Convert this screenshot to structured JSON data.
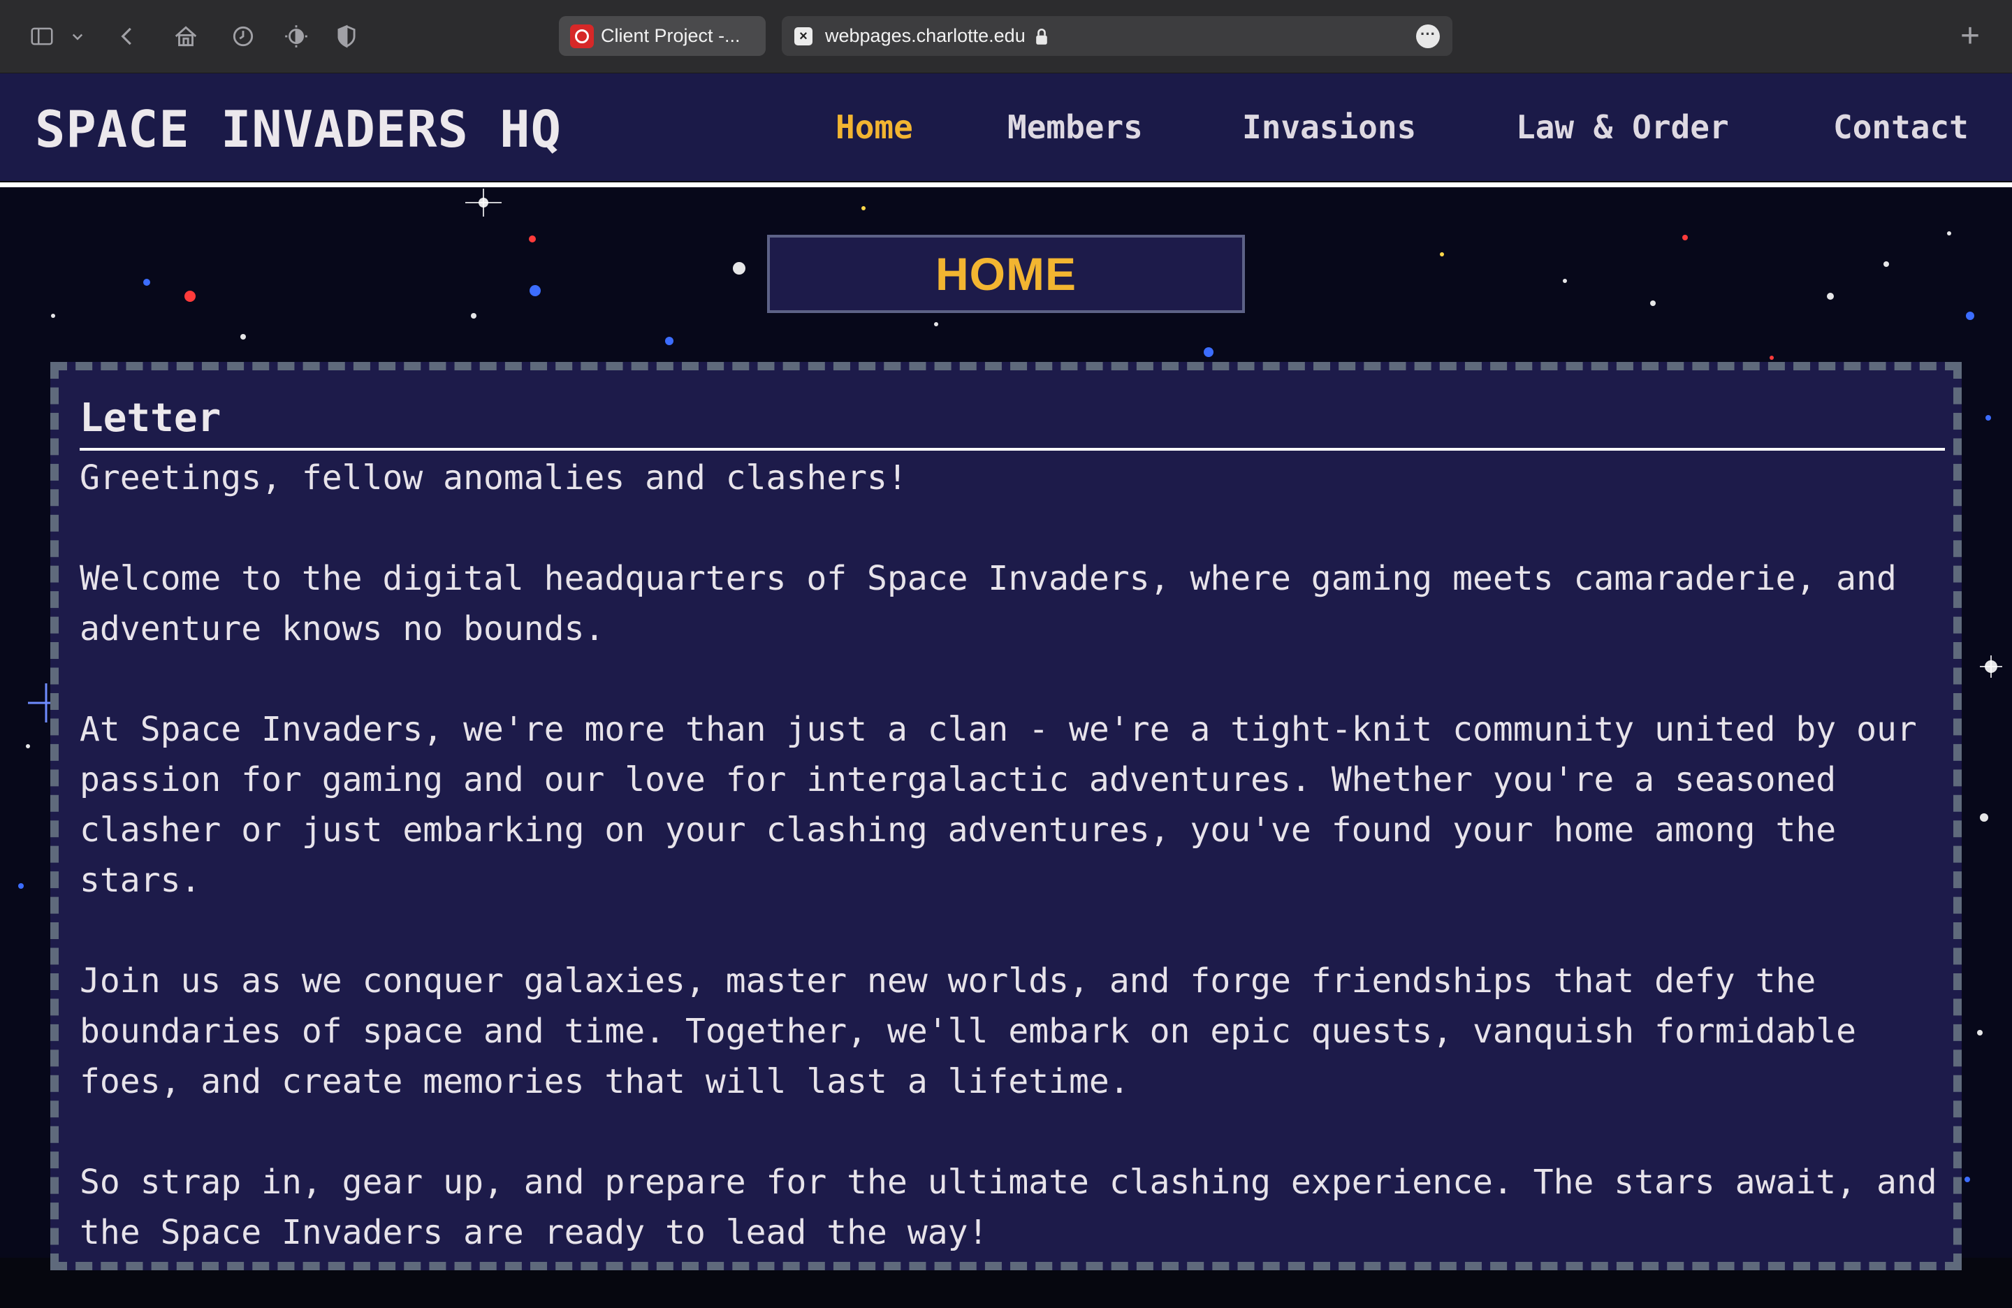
{
  "browser": {
    "tabs": [
      {
        "title": "Client Project -...",
        "active": false
      },
      {
        "title": "webpages.charlotte.edu",
        "active": true
      }
    ],
    "icons": [
      "sidebar-icon",
      "chevron-down-icon",
      "back-icon",
      "home-icon",
      "history-icon",
      "theme-icon",
      "shield-icon",
      "lock-icon",
      "more-icon",
      "new-tab-icon"
    ]
  },
  "site": {
    "logo": "SPACE INVADERS HQ",
    "nav": [
      {
        "label": "Home",
        "active": true
      },
      {
        "label": "Members",
        "active": false
      },
      {
        "label": "Invasions",
        "active": false
      },
      {
        "label": "Law & Order",
        "active": false
      },
      {
        "label": "Contact",
        "active": false
      }
    ],
    "page_title": "HOME",
    "accent_color": "#f2b531",
    "header_color": "#1b1a48"
  },
  "letter": {
    "heading": "Letter",
    "paragraphs": [
      "Greetings, fellow anomalies and clashers!",
      "Welcome to the digital headquarters of Space Invaders, where gaming meets camaraderie, and adventure knows no bounds.",
      "At Space Invaders, we're more than just a clan - we're a tight-knit community united by our passion for gaming and our love for intergalactic adventures. Whether you're a seasoned clasher or just embarking on your clashing adventures, you've found your home among the stars.",
      "Join us as we conquer galaxies, master new worlds, and forge friendships that defy the boundaries of space and time. Together, we'll embark on epic quests, vanquish formidable foes, and create memories that will last a lifetime.",
      "So strap in, gear up, and prepare for the ultimate clashing experience. The stars await, and the Space Invaders are ready to lead the way!"
    ]
  }
}
